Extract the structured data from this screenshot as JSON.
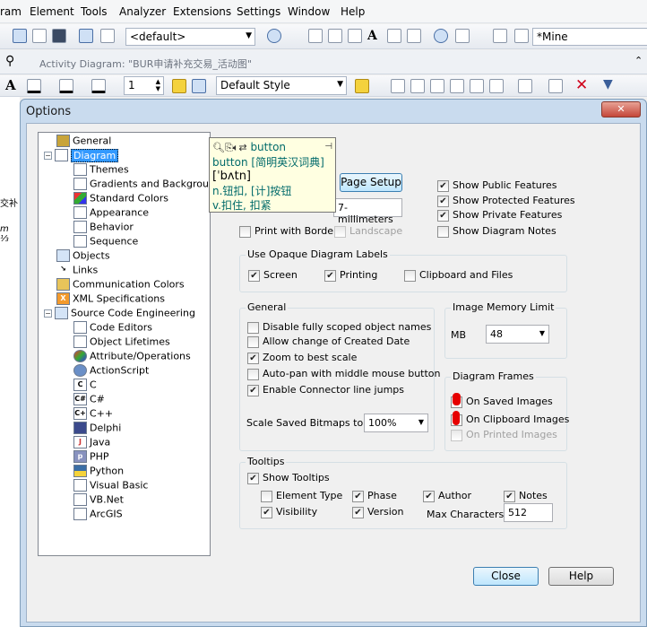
{
  "menubar": {
    "items": [
      "ram",
      "Element",
      "Tools",
      "Analyzer",
      "Extensions",
      "Settings",
      "Window",
      "Help"
    ]
  },
  "toolbar1": {
    "combo_left": "<default>",
    "combo_right": "*Mine"
  },
  "toolbar2": {
    "tab_title": "Activity Diagram: \"BUR申请补充交易_活动图\""
  },
  "toolbar3": {
    "spinner_value": "1",
    "style_combo": "Default Style"
  },
  "side": {
    "left_text1": "交补",
    "left_text2": "m ⅓"
  },
  "dialog": {
    "title": "Options",
    "close_x": "✕",
    "tree": [
      {
        "label": "General",
        "level": 0
      },
      {
        "label": "Diagram",
        "level": 0,
        "selected": true,
        "expanded": true
      },
      {
        "label": "Themes",
        "level": 1
      },
      {
        "label": "Gradients and Background",
        "level": 1
      },
      {
        "label": "Standard Colors",
        "level": 1
      },
      {
        "label": "Appearance",
        "level": 1
      },
      {
        "label": "Behavior",
        "level": 1
      },
      {
        "label": "Sequence",
        "level": 1
      },
      {
        "label": "Objects",
        "level": 0
      },
      {
        "label": "Links",
        "level": 0
      },
      {
        "label": "Communication Colors",
        "level": 0
      },
      {
        "label": "XML Specifications",
        "level": 0
      },
      {
        "label": "Source Code Engineering",
        "level": 0,
        "expanded": true
      },
      {
        "label": "Code Editors",
        "level": 1
      },
      {
        "label": "Object Lifetimes",
        "level": 1
      },
      {
        "label": "Attribute/Operations",
        "level": 1
      },
      {
        "label": "ActionScript",
        "level": 1
      },
      {
        "label": "C",
        "level": 1
      },
      {
        "label": "C#",
        "level": 1
      },
      {
        "label": "C++",
        "level": 1
      },
      {
        "label": "Delphi",
        "level": 1
      },
      {
        "label": "Java",
        "level": 1
      },
      {
        "label": "PHP",
        "level": 1
      },
      {
        "label": "Python",
        "level": 1
      },
      {
        "label": "Visual Basic",
        "level": 1
      },
      {
        "label": "VB.Net",
        "level": 1
      },
      {
        "label": "ArcGIS",
        "level": 1
      }
    ],
    "page_setup_button": "Page Setup",
    "paper_units_value": "7-millimeters",
    "print_with_border": "Print with Border",
    "landscape": "Landscape",
    "features": [
      "Show Public Features",
      "Show Protected Features",
      "Show Private Features",
      "Show Diagram Notes"
    ],
    "opaque": {
      "title": "Use Opaque Diagram Labels",
      "screen": "Screen",
      "printing": "Printing",
      "clipboard": "Clipboard and Files"
    },
    "general": {
      "title": "General",
      "options": [
        "Disable fully scoped object names",
        "Allow change of Created Date",
        "Zoom to best scale",
        "Auto-pan with middle mouse button",
        "Enable Connector line jumps"
      ],
      "scale_label": "Scale Saved Bitmaps to",
      "scale_value": "100%"
    },
    "image_memory": {
      "title": "Image Memory Limit",
      "mb_label": "MB",
      "mb_value": "48"
    },
    "diagram_frames": {
      "title": "Diagram Frames",
      "options": [
        "On Saved Images",
        "On Clipboard Images",
        "On Printed Images"
      ]
    },
    "tooltips": {
      "title": "Tooltips",
      "show_tooltips": "Show Tooltips",
      "element_type": "Element Type",
      "phase": "Phase",
      "author": "Author",
      "notes": "Notes",
      "visibility": "Visibility",
      "version": "Version",
      "max_chars_label": "Max Characters:",
      "max_chars_value": "512"
    },
    "close_button": "Close",
    "help_button": "Help"
  },
  "dict_tooltip": {
    "word": "button",
    "line1": "button [简明英汉词典]",
    "line2": "[ˈbʌtn]",
    "line3": "n.钮扣, [计]按钮",
    "line4": "v.扣住, 扣紧"
  }
}
